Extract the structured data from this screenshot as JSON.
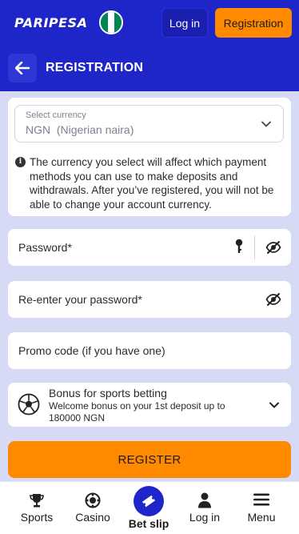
{
  "header": {
    "logo": "PARIPESA",
    "login_label": "Log in",
    "registration_label": "Registration",
    "flag_colors": [
      "#008751",
      "#ffffff",
      "#008751"
    ]
  },
  "page": {
    "title": "REGISTRATION"
  },
  "currency": {
    "label": "Select currency",
    "value": "NGN  (Nigerian naira)",
    "info": "The currency you select will affect which payment methods you can use to make deposits and withdrawals. After you’ve registered, you will not be able to change your account currency."
  },
  "form": {
    "password_placeholder": "Password*",
    "repassword_placeholder": "Re-enter your password*",
    "promo_placeholder": "Promo code (if you have one)"
  },
  "bonus": {
    "title": "Bonus for sports betting",
    "description": "Welcome bonus on your 1st deposit up to 180000 NGN"
  },
  "register_label": "REGISTER",
  "nav": {
    "sports": "Sports",
    "casino": "Casino",
    "betslip": "Bet slip",
    "login": "Log in",
    "menu": "Menu"
  },
  "colors": {
    "brand_blue": "#1e26c9",
    "accent_orange": "#ff8a00",
    "background": "#d6daf5"
  }
}
